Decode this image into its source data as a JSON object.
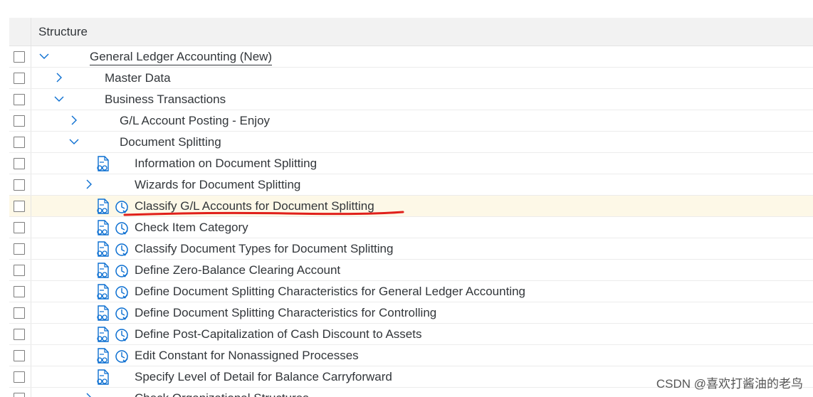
{
  "tree": {
    "header": "Structure",
    "rows": [
      {
        "label": "General Ledger Accounting (New)",
        "expander": "expanded",
        "level": 0,
        "doc": false,
        "clock": false,
        "underlined": true
      },
      {
        "label": "Master Data",
        "expander": "collapsed",
        "level": 1,
        "doc": false,
        "clock": false
      },
      {
        "label": "Business Transactions",
        "expander": "expanded",
        "level": 1,
        "doc": false,
        "clock": false
      },
      {
        "label": "G/L Account Posting - Enjoy",
        "expander": "collapsed",
        "level": 2,
        "doc": false,
        "clock": false
      },
      {
        "label": "Document Splitting",
        "expander": "expanded",
        "level": 2,
        "doc": false,
        "clock": false
      },
      {
        "label": "Information on Document Splitting",
        "expander": "none",
        "level": 3,
        "doc": true,
        "clock": false
      },
      {
        "label": "Wizards for Document Splitting",
        "expander": "collapsed",
        "level": 3,
        "doc": false,
        "clock": false
      },
      {
        "label": "Classify G/L Accounts for Document Splitting",
        "expander": "none",
        "level": 3,
        "doc": true,
        "clock": true,
        "highlighted": true
      },
      {
        "label": "Check Item Category",
        "expander": "none",
        "level": 3,
        "doc": true,
        "clock": true
      },
      {
        "label": "Classify Document Types for Document Splitting",
        "expander": "none",
        "level": 3,
        "doc": true,
        "clock": true
      },
      {
        "label": "Define Zero-Balance Clearing Account",
        "expander": "none",
        "level": 3,
        "doc": true,
        "clock": true
      },
      {
        "label": "Define Document Splitting Characteristics for General Ledger Accounting",
        "expander": "none",
        "level": 3,
        "doc": true,
        "clock": true
      },
      {
        "label": "Define Document Splitting Characteristics for Controlling",
        "expander": "none",
        "level": 3,
        "doc": true,
        "clock": true
      },
      {
        "label": "Define Post-Capitalization of Cash Discount to Assets",
        "expander": "none",
        "level": 3,
        "doc": true,
        "clock": true
      },
      {
        "label": "Edit Constant for Nonassigned Processes",
        "expander": "none",
        "level": 3,
        "doc": true,
        "clock": true
      },
      {
        "label": "Specify Level of Detail for Balance Carryforward",
        "expander": "none",
        "level": 3,
        "doc": true,
        "clock": false
      },
      {
        "label": "Check Organizational Structures",
        "expander": "collapsed",
        "level": 3,
        "doc": false,
        "clock": false
      }
    ]
  },
  "icons": {
    "expanded": "chevron-down-icon",
    "collapsed": "chevron-right-icon",
    "doc": "documentation-icon",
    "clock": "execute-clock-icon"
  },
  "colors": {
    "accent": "#0a6ed1",
    "highlight_row": "#fdf8e7",
    "annotation": "#e0201b"
  },
  "watermark": "CSDN @喜欢打酱油的老鸟"
}
